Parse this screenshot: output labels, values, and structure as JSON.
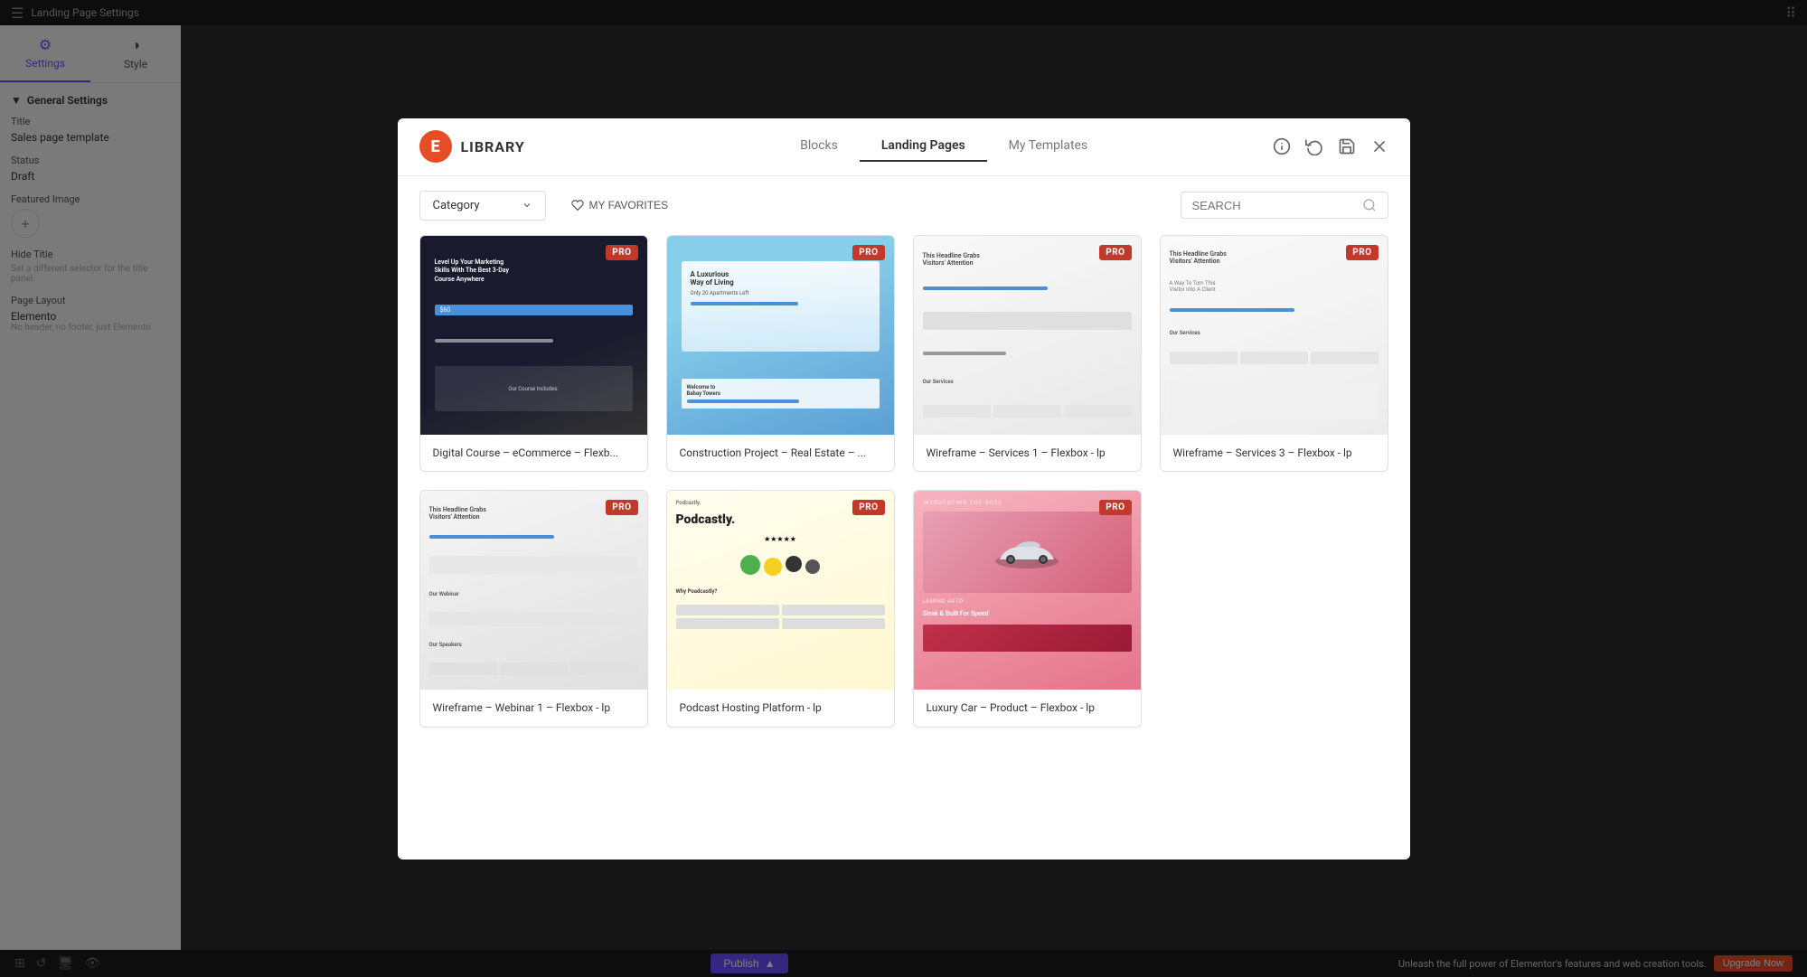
{
  "editor": {
    "title": "Landing Page Settings",
    "tabs": [
      {
        "label": "Settings",
        "active": true
      },
      {
        "label": "Style",
        "active": false
      }
    ],
    "sections": {
      "general": {
        "title": "General Settings",
        "fields": {
          "title_label": "Title",
          "title_value": "Sales page template",
          "status_label": "Status",
          "status_value": "Draft",
          "featured_image_label": "Featured Image",
          "hide_title_label": "Hide Title",
          "hide_title_desc": "Set a different selector for the title panel.",
          "page_layout_label": "Page Layout",
          "page_layout_value": "Elemento",
          "page_layout_desc": "No header, no footer, just Elemento"
        }
      }
    },
    "bottom_bar": {
      "publish_label": "Publish",
      "notice": "Unleash the full power of Elementor's features and web creation tools.",
      "upgrade_label": "Upgrade Now"
    }
  },
  "library_modal": {
    "logo_letter": "E",
    "title": "LIBRARY",
    "tabs": [
      {
        "label": "Blocks",
        "active": false
      },
      {
        "label": "Landing Pages",
        "active": true
      },
      {
        "label": "My Templates",
        "active": false
      }
    ],
    "toolbar": {
      "category_label": "Category",
      "favorites_label": "MY FAVORITES",
      "search_placeholder": "SEARCH"
    },
    "header_icons": [
      {
        "name": "info-icon",
        "symbol": "ⓘ"
      },
      {
        "name": "refresh-icon",
        "symbol": "↻"
      },
      {
        "name": "save-icon",
        "symbol": "💾"
      },
      {
        "name": "close-icon",
        "symbol": "✕"
      }
    ],
    "templates": [
      {
        "id": "digital-course",
        "title": "Digital Course – eCommerce – Flexb...",
        "badge": "PRO",
        "thumb_type": "digital"
      },
      {
        "id": "construction",
        "title": "Construction Project – Real Estate – ...",
        "badge": "PRO",
        "thumb_type": "construction"
      },
      {
        "id": "wireframe-services-1",
        "title": "Wireframe – Services 1 – Flexbox - lp",
        "badge": "PRO",
        "thumb_type": "wireframe1"
      },
      {
        "id": "wireframe-services-3",
        "title": "Wireframe – Services 3 – Flexbox - lp",
        "badge": "PRO",
        "thumb_type": "wireframe3"
      },
      {
        "id": "webinar",
        "title": "Wireframe – Webinar 1 – Flexbox - lp",
        "badge": "PRO",
        "thumb_type": "webinar"
      },
      {
        "id": "podcast",
        "title": "Podcast Hosting Platform - lp",
        "badge": "PRO",
        "thumb_type": "podcast"
      },
      {
        "id": "luxury-car",
        "title": "Luxury Car – Product – Flexbox - lp",
        "badge": "PRO",
        "thumb_type": "luxury"
      }
    ]
  }
}
